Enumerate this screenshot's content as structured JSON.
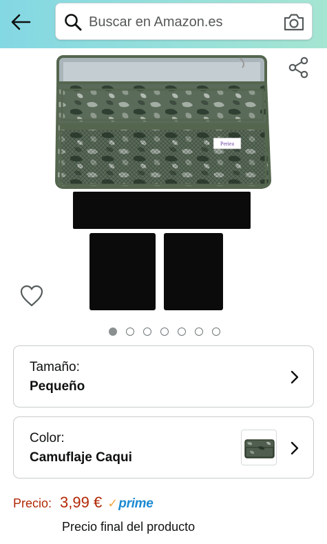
{
  "header": {
    "search": {
      "placeholder": "Buscar en Amazon.es"
    }
  },
  "gallery": {
    "image_count": 7,
    "active_index": 0,
    "badge_text": "Periea"
  },
  "options": {
    "size": {
      "label": "Tamaño:",
      "value": "Pequeño"
    },
    "color": {
      "label": "Color:",
      "value": "Camuflaje Caqui"
    }
  },
  "price": {
    "label": "Precio:",
    "value": "3,99 €",
    "prime_label": "prime",
    "note": "Precio final del producto"
  },
  "colors": {
    "header_gradient_start": "#84d8e3",
    "header_gradient_end": "#a5e5d2",
    "price": "#b12704",
    "prime_blue": "#1b8bd1",
    "prime_check": "#f3a847"
  },
  "icons": [
    "back-arrow-icon",
    "search-icon",
    "camera-icon",
    "share-icon",
    "heart-icon",
    "chevron-right-icon"
  ]
}
